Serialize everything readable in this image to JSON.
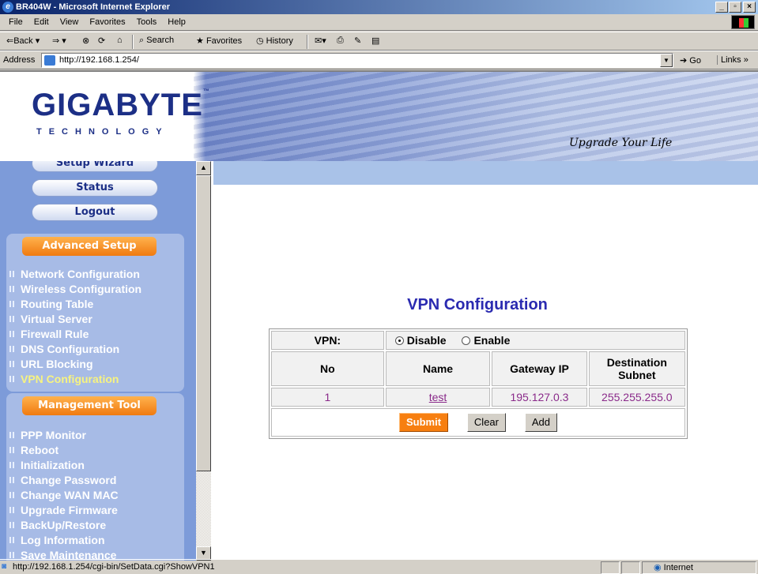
{
  "window": {
    "title": "BR404W - Microsoft Internet Explorer"
  },
  "menu": [
    "File",
    "Edit",
    "View",
    "Favorites",
    "Tools",
    "Help"
  ],
  "toolbar": {
    "back": "⇐Back ▾",
    "forward": "⇒ ▾",
    "search": "Search",
    "favorites": "Favorites",
    "history": "History"
  },
  "address": {
    "label": "Address",
    "url": "http://192.168.1.254/",
    "go": "Go",
    "links": "Links"
  },
  "header": {
    "logo": "GIGABYTE",
    "tm": "™",
    "subtitle": "TECHNOLOGY",
    "slogan": "Upgrade Your Life"
  },
  "sidebar": {
    "top_buttons": [
      "Setup Wizard",
      "Status",
      "Logout"
    ],
    "advanced_title": "Advanced Setup",
    "advanced_items": [
      "Network Configuration",
      "Wireless Configuration",
      "Routing Table",
      "Virtual Server",
      "Firewall Rule",
      "DNS Configuration",
      "URL Blocking",
      "VPN Configuration"
    ],
    "management_title": "Management Tool",
    "management_items": [
      "PPP Monitor",
      "Reboot",
      "Initialization",
      "Change Password",
      "Change WAN MAC",
      "Upgrade Firmware",
      "BackUp/Restore",
      "Log Information",
      "Save Maintenance"
    ]
  },
  "main": {
    "title": "VPN Configuration",
    "vpn_label": "VPN:",
    "disable_label": "Disable",
    "enable_label": "Enable",
    "selected": "Disable",
    "columns": [
      "No",
      "Name",
      "Gateway IP",
      "Destination Subnet"
    ],
    "rows": [
      {
        "no": "1",
        "name": "test",
        "gateway": "195.127.0.3",
        "subnet": "255.255.255.0"
      }
    ],
    "submit": "Submit",
    "clear": "Clear",
    "add": "Add"
  },
  "status": {
    "text": "http://192.168.1.254/cgi-bin/SetData.cgi?ShowVPN1",
    "zone": "Internet"
  }
}
